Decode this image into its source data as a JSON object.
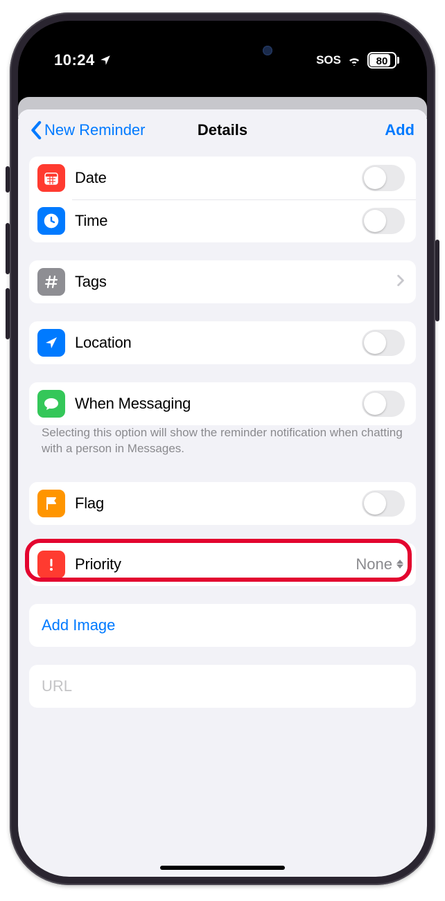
{
  "status": {
    "time": "10:24",
    "sos": "SOS",
    "battery_pct": "80"
  },
  "nav": {
    "back_label": "New Reminder",
    "title": "Details",
    "action": "Add"
  },
  "rows": {
    "date": "Date",
    "time": "Time",
    "tags": "Tags",
    "location": "Location",
    "messaging": "When Messaging",
    "flag": "Flag",
    "priority": "Priority",
    "priority_value": "None",
    "add_image": "Add Image",
    "url_placeholder": "URL"
  },
  "footer": {
    "messaging": "Selecting this option will show the reminder notification when chatting with a person in Messages."
  },
  "toggles": {
    "date": false,
    "time": false,
    "location": false,
    "messaging": false,
    "flag": false
  },
  "highlight": "priority-row"
}
